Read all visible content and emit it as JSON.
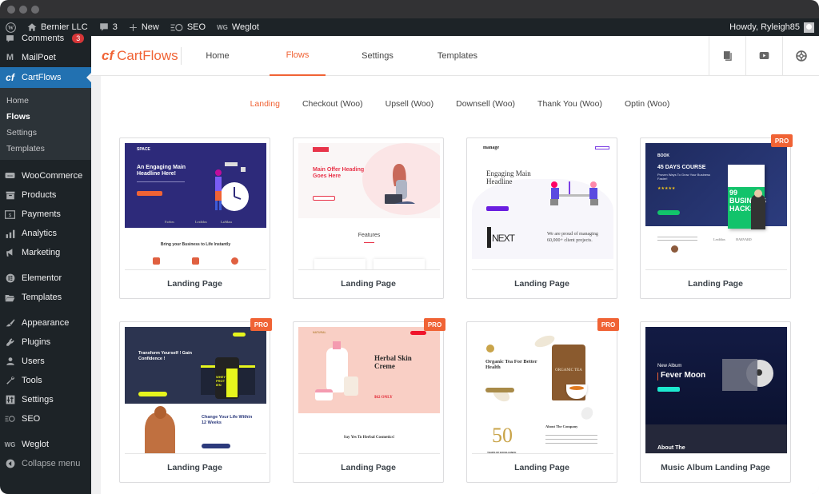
{
  "window": {
    "controls": [
      "close",
      "minimize",
      "maximize"
    ]
  },
  "admin_bar": {
    "wp_logo": "wordpress-logo",
    "site_name": "Bernier LLC",
    "comments_count": "3",
    "new_label": "New",
    "seo_label": "SEO",
    "weglot_label": "Weglot",
    "greeting": "Howdy, Ryleigh85"
  },
  "sidebar": {
    "items": [
      {
        "label": "Comments",
        "icon": "comment-icon",
        "badge": "3"
      },
      {
        "label": "MailPoet",
        "icon": "mailpoet-icon"
      },
      {
        "label": "CartFlows",
        "icon": "cartflows-icon",
        "active": true
      },
      {
        "label": "WooCommerce",
        "icon": "woocommerce-icon"
      },
      {
        "label": "Products",
        "icon": "archive-icon"
      },
      {
        "label": "Payments",
        "icon": "money-icon"
      },
      {
        "label": "Analytics",
        "icon": "bar-chart-icon"
      },
      {
        "label": "Marketing",
        "icon": "megaphone-icon"
      },
      {
        "label": "Elementor",
        "icon": "elementor-icon"
      },
      {
        "label": "Templates",
        "icon": "folder-icon"
      },
      {
        "label": "Appearance",
        "icon": "paintbrush-icon"
      },
      {
        "label": "Plugins",
        "icon": "plug-icon"
      },
      {
        "label": "Users",
        "icon": "user-icon"
      },
      {
        "label": "Tools",
        "icon": "wrench-icon"
      },
      {
        "label": "Settings",
        "icon": "sliders-icon"
      },
      {
        "label": "SEO",
        "icon": "seo-icon"
      },
      {
        "label": "Weglot",
        "icon": "weglot-icon"
      },
      {
        "label": "Collapse menu",
        "icon": "collapse-icon"
      }
    ],
    "submenu": [
      {
        "label": "Home"
      },
      {
        "label": "Flows",
        "current": true
      },
      {
        "label": "Settings"
      },
      {
        "label": "Templates"
      }
    ]
  },
  "header": {
    "brand": "CartFlows",
    "nav": [
      {
        "label": "Home"
      },
      {
        "label": "Flows",
        "active": true
      },
      {
        "label": "Settings"
      },
      {
        "label": "Templates"
      }
    ],
    "icons": [
      "docs-icon",
      "video-icon",
      "support-icon"
    ]
  },
  "tabs": [
    {
      "label": "Landing",
      "active": true
    },
    {
      "label": "Checkout (Woo)"
    },
    {
      "label": "Upsell (Woo)"
    },
    {
      "label": "Downsell (Woo)"
    },
    {
      "label": "Thank You (Woo)"
    },
    {
      "label": "Optin (Woo)"
    }
  ],
  "templates": [
    {
      "title": "Landing Page",
      "pro": false,
      "preview": {
        "brand": "SPACE",
        "headline": "An Engaging Main Headline Here!",
        "sub": "Bring your Business to Life Instantly",
        "logos": [
          "Forbes",
          "Lexiblox",
          "LaSilass"
        ]
      }
    },
    {
      "title": "Landing Page",
      "pro": false,
      "preview": {
        "headline": "Main Offer Heading Goes Here",
        "sub": "Features"
      }
    },
    {
      "title": "Landing Page",
      "pro": false,
      "preview": {
        "brand": "manage",
        "headline": "Engaging Main Headline",
        "sub": "We are proud of managing 60,000+ client projects.",
        "art": "NEXT"
      }
    },
    {
      "title": "Landing Page",
      "pro": true,
      "preview": {
        "brand": "BOOK",
        "headline": "45 DAYS COURSE",
        "sub": "Proven Ways To Grow Your Business Faster!",
        "book": "99 BUSINESS HACKS",
        "logos": [
          "Lexiblox",
          "HARVARD"
        ]
      }
    },
    {
      "title": "Landing Page",
      "pro": true,
      "preview": {
        "headline": "Transform Yourself ! Gain Confidence !",
        "sub": "Change Your Life Within 12 Weeks",
        "product": "WHEY PROTIEN"
      }
    },
    {
      "title": "Landing Page",
      "pro": true,
      "preview": {
        "brand": "NATURAL",
        "headline": "Herbal Skin Creme",
        "price": "$62 ONLY",
        "sub": "Say Yes To Herbal Cosmetics!"
      }
    },
    {
      "title": "Landing Page",
      "pro": true,
      "preview": {
        "headline": "Organic Tea For Better Health",
        "product": "ORGANIC TEA",
        "sub": "About The Company",
        "years": "50",
        "years_label": "YEARS OF EXCELLENCE"
      }
    },
    {
      "title": "Music Album Landing Page",
      "pro": false,
      "preview": {
        "kicker": "New Album",
        "headline": "Fever Moon",
        "sub": "About The"
      }
    }
  ],
  "pro_label": "PRO",
  "colors": {
    "accent": "#f06335",
    "wp_blue": "#2271b1",
    "admin_dark": "#1d2327"
  }
}
